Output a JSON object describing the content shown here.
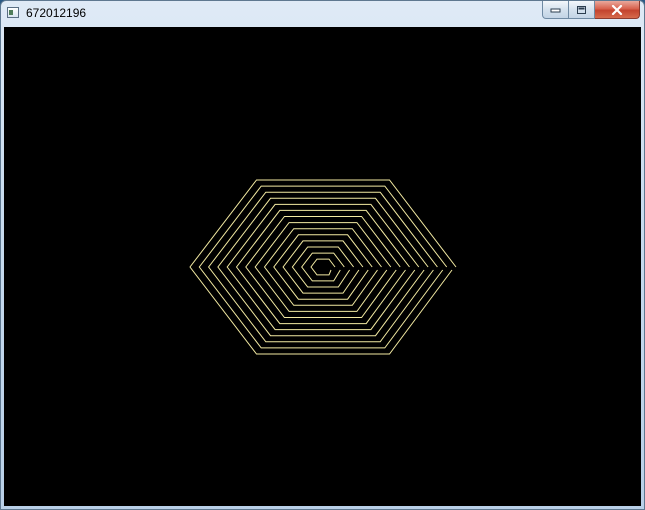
{
  "window": {
    "title": "672012196",
    "buttons": {
      "minimize_icon": "minimize-icon",
      "maximize_icon": "maximize-icon",
      "close_icon": "close-icon"
    }
  },
  "canvas": {
    "background": "#000000",
    "stroke_color": "#f3eaa2",
    "shape": "concentric hexagons",
    "ring_count": 14
  }
}
